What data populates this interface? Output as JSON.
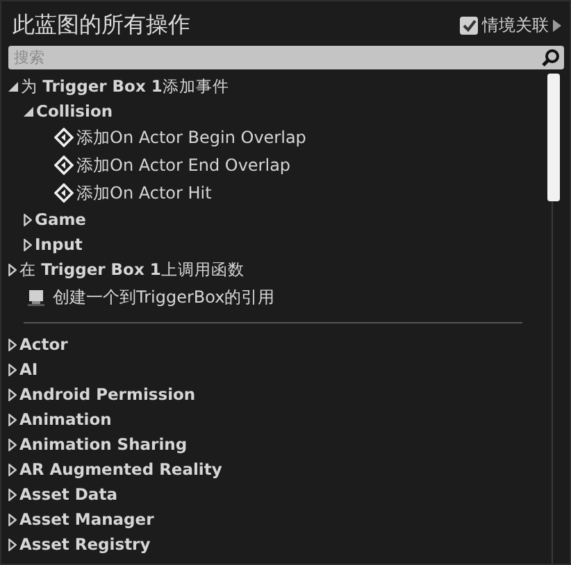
{
  "title": "此蓝图的所有操作",
  "context_toggle": {
    "label": "情境关联",
    "checked": true
  },
  "search": {
    "placeholder": "搜索"
  },
  "tree": [
    {
      "kind": "section",
      "label": "为 **Trigger Box 1**添加事件",
      "expanded": true,
      "children": [
        {
          "kind": "category",
          "label": "Collision",
          "expanded": true,
          "children": [
            {
              "kind": "action",
              "label": "添加On Actor Begin Overlap"
            },
            {
              "kind": "action",
              "label": "添加On Actor End Overlap"
            },
            {
              "kind": "action",
              "label": "添加On Actor Hit"
            }
          ]
        },
        {
          "kind": "category",
          "label": "Game",
          "expanded": false
        },
        {
          "kind": "category",
          "label": "Input",
          "expanded": false
        }
      ]
    },
    {
      "kind": "section",
      "label": "在 **Trigger Box 1**上调用函数",
      "expanded": false
    },
    {
      "kind": "reference",
      "label": "创建一个到TriggerBox的引用"
    }
  ],
  "categories": [
    {
      "label": "Actor",
      "expanded": false
    },
    {
      "label": "AI",
      "expanded": false
    },
    {
      "label": "Android Permission",
      "expanded": false
    },
    {
      "label": "Animation",
      "expanded": false
    },
    {
      "label": "Animation Sharing",
      "expanded": false
    },
    {
      "label": "AR Augmented Reality",
      "expanded": false
    },
    {
      "label": "Asset Data",
      "expanded": false
    },
    {
      "label": "Asset Manager",
      "expanded": false
    },
    {
      "label": "Asset Registry",
      "expanded": false
    }
  ]
}
